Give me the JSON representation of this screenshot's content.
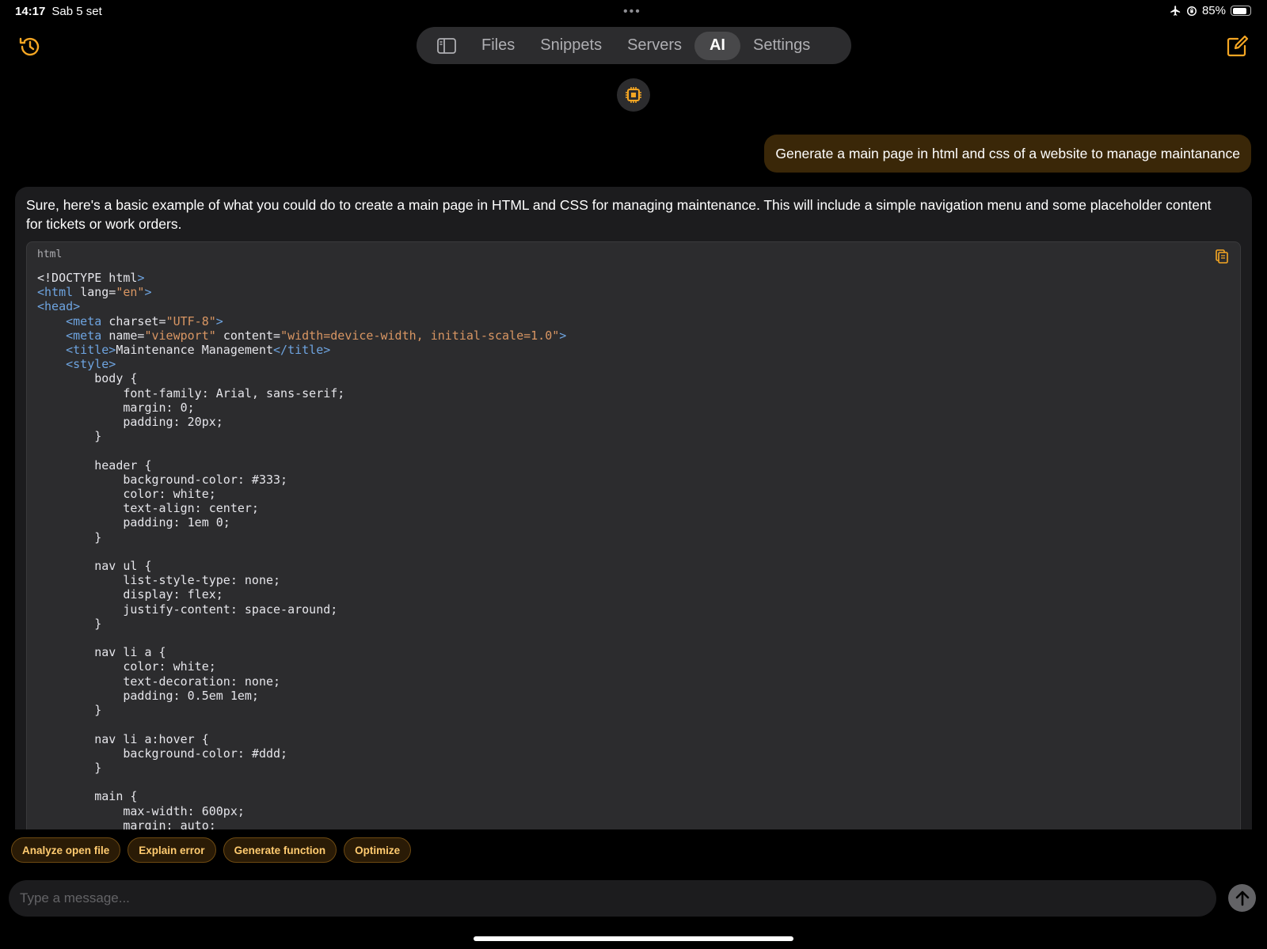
{
  "status_bar": {
    "time": "14:17",
    "date": "Sab 5 set",
    "battery": "85%",
    "battery_level": 0.85,
    "icons": [
      "airplane-icon",
      "orientation-lock-icon",
      "battery-icon"
    ]
  },
  "header": {
    "history_icon": "history-icon",
    "compose_icon": "compose-icon",
    "tabs": [
      {
        "label": "Files"
      },
      {
        "label": "Snippets"
      },
      {
        "label": "Servers"
      },
      {
        "label": "AI"
      },
      {
        "label": "Settings"
      }
    ],
    "active_tab": "AI"
  },
  "colors": {
    "accent": "#f5a623",
    "user_bubble": "#3a2708",
    "card_bg": "#1c1c1e",
    "code_bg": "#2c2c2e"
  },
  "conversation": {
    "user_message": "Generate a main page in html and css of a website to manage maintanance",
    "assistant_text": "Sure, here's a basic example of what you could do to create a main page in HTML and CSS for managing maintenance. This will include a simple navigation menu and some placeholder content for tickets or work orders.",
    "code_block": {
      "language": "html",
      "lines": [
        [
          [
            "a",
            "<!DOCTYPE html"
          ],
          [
            "t",
            ">"
          ]
        ],
        [
          [
            "t",
            "<html "
          ],
          [
            "a",
            "lang="
          ],
          [
            "s",
            "\"en\""
          ],
          [
            "t",
            ">"
          ]
        ],
        [
          [
            "t",
            "<head>"
          ]
        ],
        [
          [
            "a",
            "    "
          ],
          [
            "t",
            "<meta "
          ],
          [
            "a",
            "charset="
          ],
          [
            "s",
            "\"UTF-8\""
          ],
          [
            "t",
            ">"
          ]
        ],
        [
          [
            "a",
            "    "
          ],
          [
            "t",
            "<meta "
          ],
          [
            "a",
            "name="
          ],
          [
            "s",
            "\"viewport\" "
          ],
          [
            "a",
            "content="
          ],
          [
            "s",
            "\"width=device-width, initial-scale=1.0\""
          ],
          [
            "t",
            ">"
          ]
        ],
        [
          [
            "a",
            "    "
          ],
          [
            "t",
            "<title>"
          ],
          [
            "a",
            "Maintenance Management"
          ],
          [
            "t",
            "</title>"
          ]
        ],
        [
          [
            "a",
            "    "
          ],
          [
            "t",
            "<style>"
          ]
        ],
        [
          [
            "a",
            "        body {"
          ]
        ],
        [
          [
            "a",
            "            font-family: Arial, sans-serif;"
          ]
        ],
        [
          [
            "a",
            "            margin: 0;"
          ]
        ],
        [
          [
            "a",
            "            padding: 20px;"
          ]
        ],
        [
          [
            "a",
            "        }"
          ]
        ],
        [
          [
            "a",
            ""
          ]
        ],
        [
          [
            "a",
            "        header {"
          ]
        ],
        [
          [
            "a",
            "            background-color: #333;"
          ]
        ],
        [
          [
            "a",
            "            color: white;"
          ]
        ],
        [
          [
            "a",
            "            text-align: center;"
          ]
        ],
        [
          [
            "a",
            "            padding: 1em 0;"
          ]
        ],
        [
          [
            "a",
            "        }"
          ]
        ],
        [
          [
            "a",
            ""
          ]
        ],
        [
          [
            "a",
            "        nav ul {"
          ]
        ],
        [
          [
            "a",
            "            list-style-type: none;"
          ]
        ],
        [
          [
            "a",
            "            display: flex;"
          ]
        ],
        [
          [
            "a",
            "            justify-content: space-around;"
          ]
        ],
        [
          [
            "a",
            "        }"
          ]
        ],
        [
          [
            "a",
            ""
          ]
        ],
        [
          [
            "a",
            "        nav li a {"
          ]
        ],
        [
          [
            "a",
            "            color: white;"
          ]
        ],
        [
          [
            "a",
            "            text-decoration: none;"
          ]
        ],
        [
          [
            "a",
            "            padding: 0.5em 1em;"
          ]
        ],
        [
          [
            "a",
            "        }"
          ]
        ],
        [
          [
            "a",
            ""
          ]
        ],
        [
          [
            "a",
            "        nav li a:hover {"
          ]
        ],
        [
          [
            "a",
            "            background-color: #ddd;"
          ]
        ],
        [
          [
            "a",
            "        }"
          ]
        ],
        [
          [
            "a",
            ""
          ]
        ],
        [
          [
            "a",
            "        main {"
          ]
        ],
        [
          [
            "a",
            "            max-width: 600px;"
          ]
        ],
        [
          [
            "a",
            "            margin: auto;"
          ]
        ]
      ]
    }
  },
  "suggestions": [
    {
      "label": "Analyze open file"
    },
    {
      "label": "Explain error"
    },
    {
      "label": "Generate function"
    },
    {
      "label": "Optimize"
    }
  ],
  "composer": {
    "placeholder": "Type a message..."
  }
}
